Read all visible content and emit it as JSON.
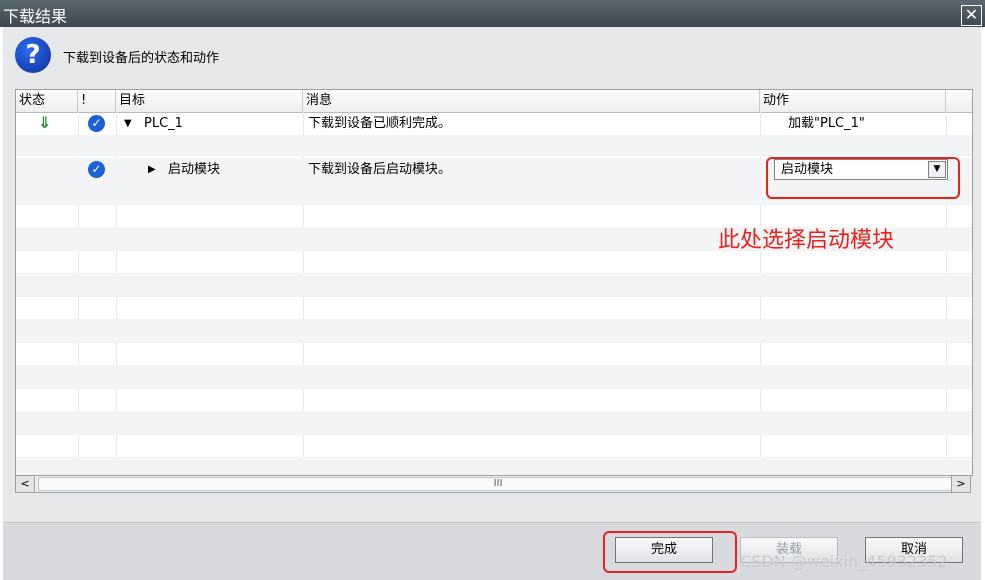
{
  "window": {
    "title": "下载结果",
    "close_glyph": "✕"
  },
  "header": {
    "icon": "question-icon",
    "icon_glyph": "?",
    "text": "下载到设备后的状态和动作"
  },
  "table": {
    "columns": [
      "状态",
      "!",
      "目标",
      "消息",
      "动作"
    ],
    "rows": [
      {
        "status_icon": "download-icon",
        "status_glyph": "⇓",
        "check": "✓",
        "target": "PLC_1",
        "expand": "▼",
        "message": "下载到设备已顺利完成。",
        "action": "加载\"PLC_1\""
      },
      {
        "status_icon": "",
        "check": "",
        "target": "",
        "message": "",
        "action": ""
      },
      {
        "status_icon": "",
        "check": "✓",
        "target": "启动模块",
        "expand": "▶",
        "message": "下载到设备后启动模块。",
        "action_select": "启动模块",
        "dropdown_glyph": "▼"
      }
    ]
  },
  "annotation": {
    "text": "此处选择启动模块",
    "color": "#e8231e"
  },
  "scrollbar": {
    "left": "<",
    "right": ">",
    "thumb": "III"
  },
  "footer": {
    "finish_label": "完成",
    "load_label": "装载",
    "cancel_label": "取消"
  },
  "watermark": "CSDN @weixin_45932352"
}
